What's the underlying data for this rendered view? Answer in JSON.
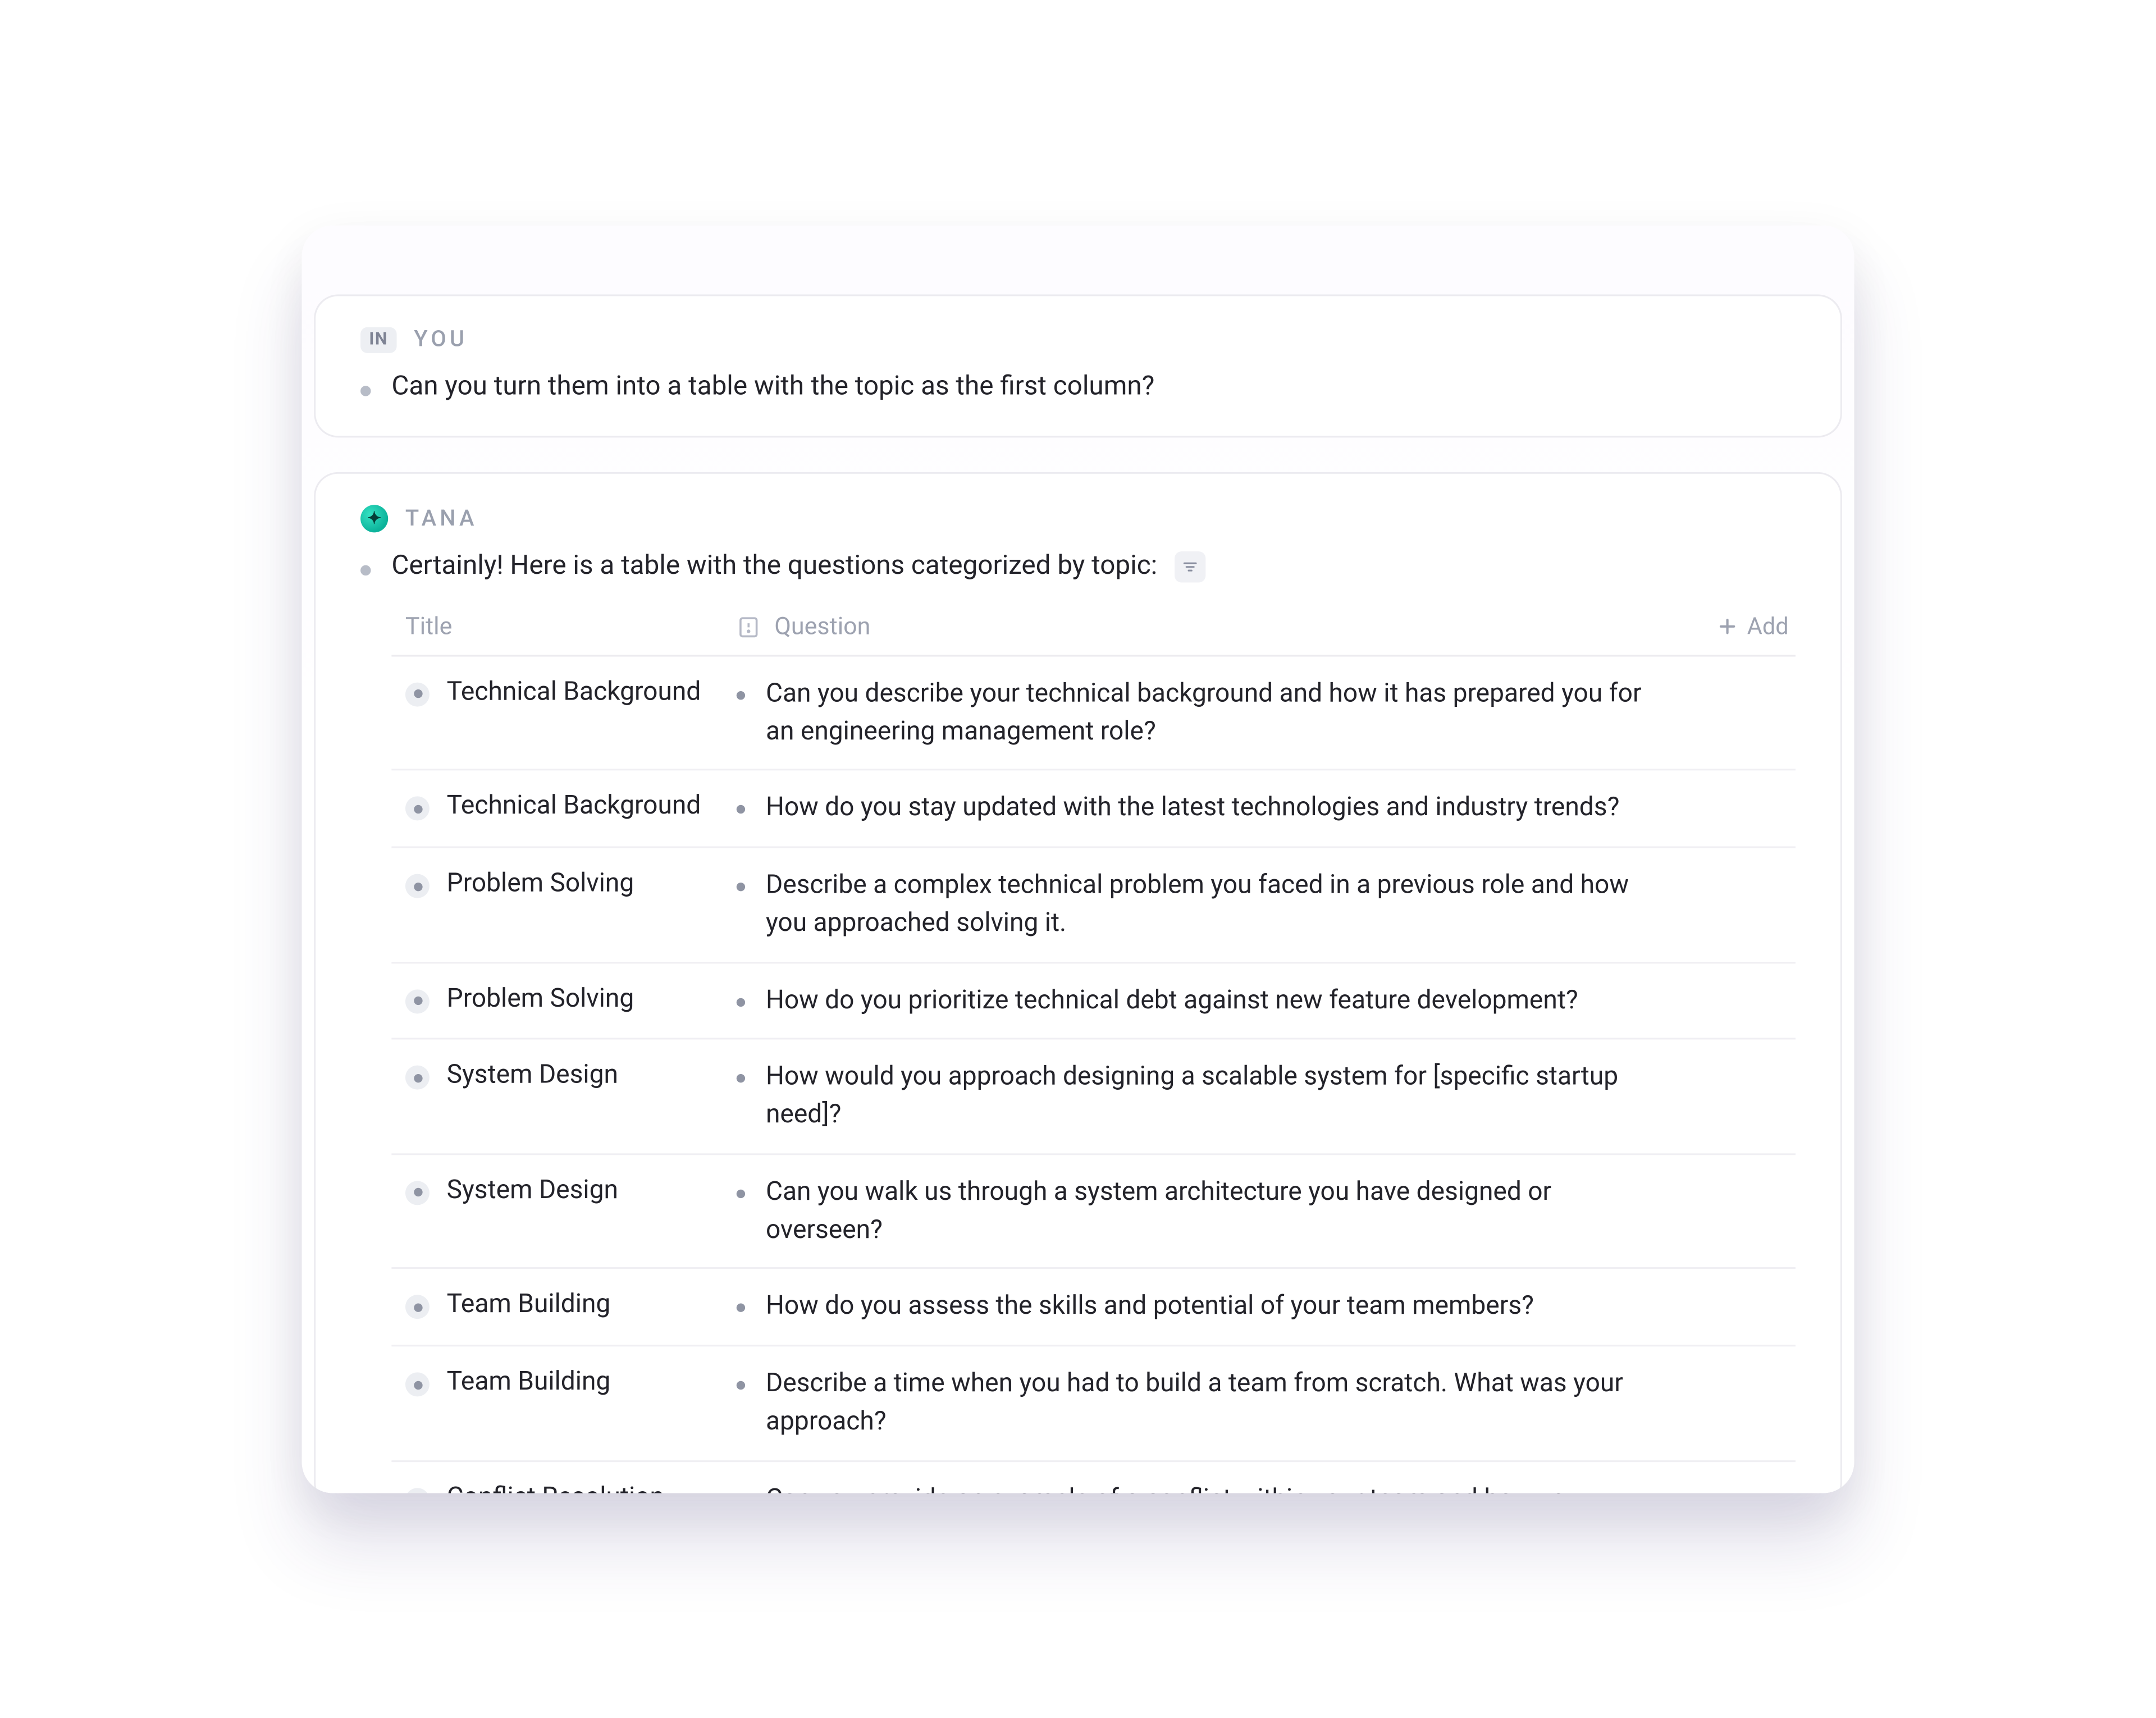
{
  "user_block": {
    "badge": "IN",
    "speaker": "YOU",
    "message": "Can you turn them into a table with the topic as the first column?"
  },
  "tana_block": {
    "speaker": "TANA",
    "intro": "Certainly! Here is a table with the questions categorized by topic:",
    "columns": {
      "title": "Title",
      "question": "Question",
      "add": "Add"
    },
    "rows": [
      {
        "title": "Technical Background",
        "question": "Can you describe your technical background and how it has prepared you for an engineering management role?"
      },
      {
        "title": "Technical Background",
        "question": "How do you stay updated with the latest technologies and industry trends?"
      },
      {
        "title": "Problem Solving",
        "question": "Describe a complex technical problem you faced in a previous role and how you approached solving it."
      },
      {
        "title": "Problem Solving",
        "question": "How do you prioritize technical debt against new feature development?"
      },
      {
        "title": "System Design",
        "question": "How would you approach designing a scalable system for [specific startup need]?"
      },
      {
        "title": "System Design",
        "question": "Can you walk us through a system architecture you have designed or overseen?"
      },
      {
        "title": "Team Building",
        "question": "How do you assess the skills and potential of your team members?"
      },
      {
        "title": "Team Building",
        "question": "Describe a time when you had to build a team from scratch. What was your approach?"
      },
      {
        "title": "Conflict Resolution",
        "question": "Can you provide an example of a conflict within your team and how you resolved it?"
      }
    ]
  }
}
